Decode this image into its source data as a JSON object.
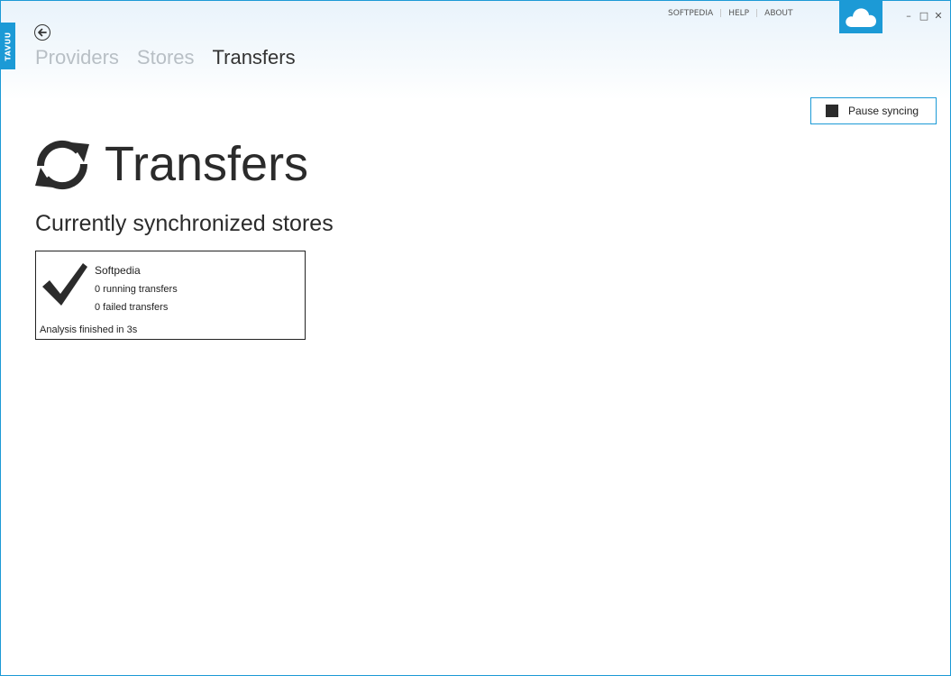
{
  "app": {
    "side_tab_label": "TAVUU"
  },
  "top_links": {
    "softpedia": "SOFTPEDIA",
    "help": "HELP",
    "about": "ABOUT"
  },
  "window_controls": {
    "minimize": "–",
    "maximize": "□",
    "close": "✕"
  },
  "nav": {
    "tabs": [
      {
        "label": "Providers",
        "active": false
      },
      {
        "label": "Stores",
        "active": false
      },
      {
        "label": "Transfers",
        "active": true
      }
    ]
  },
  "toolbar": {
    "pause_label": "Pause syncing"
  },
  "page": {
    "title": "Transfers",
    "subtitle": "Currently synchronized stores"
  },
  "stores": [
    {
      "name": "Softpedia",
      "running": "0 running transfers",
      "failed": "0 failed transfers",
      "status": "Analysis finished in 3s"
    }
  ],
  "colors": {
    "accent": "#1c9ad6",
    "text": "#2b2b2b",
    "inactive_tab": "#b8bfc5"
  },
  "icons": [
    "cloud-icon",
    "back-arrow-icon",
    "sync-icon",
    "checkmark-icon",
    "stop-icon"
  ]
}
